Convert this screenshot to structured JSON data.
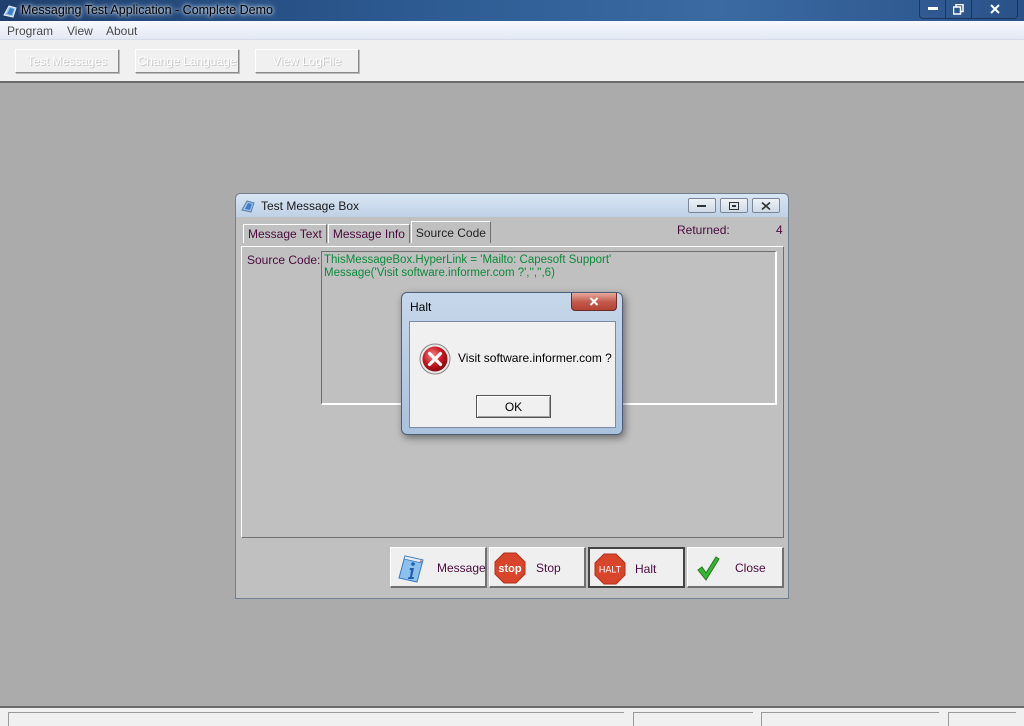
{
  "main_window": {
    "title": "Messaging Test Application - Complete Demo",
    "controls": {
      "minimize": "minimize",
      "restore": "restore",
      "close": "close"
    }
  },
  "menu": {
    "items": [
      {
        "label": "Program"
      },
      {
        "label": "View"
      },
      {
        "label": "About"
      }
    ]
  },
  "toolbar": {
    "buttons": [
      {
        "label": "Test Messages",
        "enabled": false
      },
      {
        "label": "Change Language",
        "enabled": false
      },
      {
        "label": "View LogFile",
        "enabled": false
      }
    ]
  },
  "test_message_box": {
    "title": "Test Message Box",
    "tabs": [
      {
        "label": "Message Text",
        "active": false
      },
      {
        "label": "Message Info",
        "active": false
      },
      {
        "label": "Source Code",
        "active": true
      }
    ],
    "returned_label": "Returned:",
    "returned_value": "4",
    "source_code_label": "Source Code:",
    "source_code_lines": [
      "ThisMessageBox.HyperLink = 'Mailto: Capesoft Support'",
      "Message('Visit software.informer.com ?','','',6)"
    ],
    "buttons": [
      {
        "label": "Message",
        "icon": "info-icon"
      },
      {
        "label": "Stop",
        "icon": "stop-sign-icon"
      },
      {
        "label": "Halt",
        "icon": "halt-sign-icon"
      },
      {
        "label": "Close",
        "icon": "checkmark-icon"
      }
    ],
    "stop_icon_text": "stop",
    "halt_icon_text": "HALT"
  },
  "halt_dialog": {
    "title": "Halt",
    "message": "Visit software.informer.com ?",
    "ok_label": "OK",
    "icon": "error-icon"
  },
  "colors": {
    "source_text": "#0d8a3a",
    "label_text": "#4b0a3e",
    "desktop_bg": "#ababab"
  }
}
